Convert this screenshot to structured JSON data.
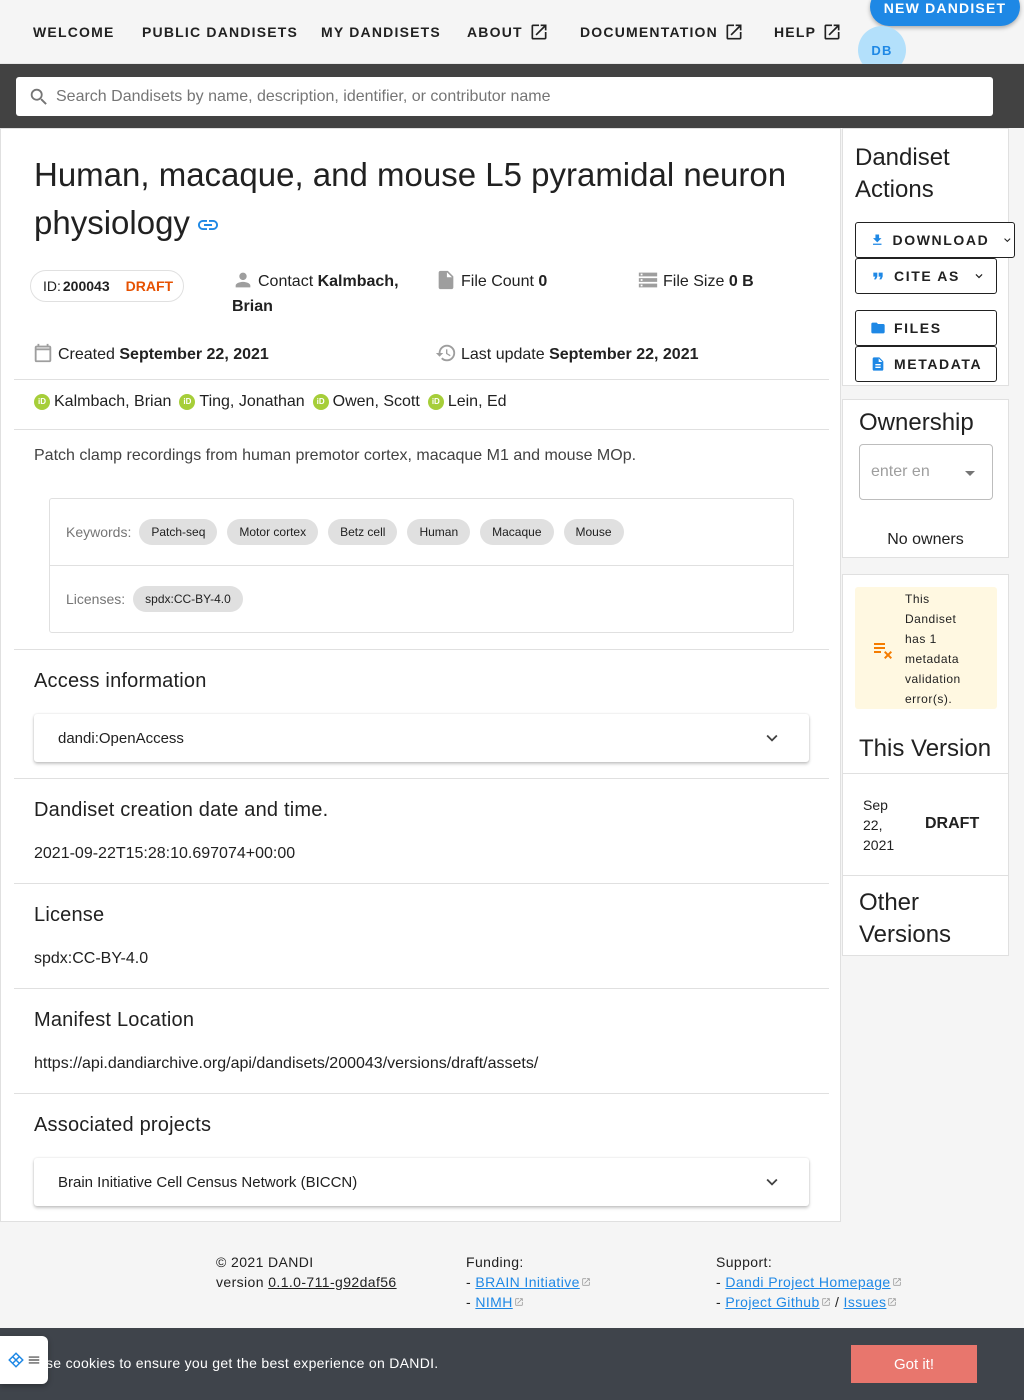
{
  "nav": {
    "welcome": "WELCOME",
    "public_dandisets": "PUBLIC DANDISETS",
    "my_dandisets": "MY DANDISETS",
    "about": "ABOUT",
    "documentation": "DOCUMENTATION",
    "help": "HELP",
    "new_dandiset": "NEW DANDISET",
    "avatar_initials": "DB"
  },
  "search": {
    "placeholder": "Search Dandisets by name, description, identifier, or contributor name"
  },
  "dandiset": {
    "title": "Human, macaque, and mouse L5 pyramidal neuron physiology",
    "id_label": "ID:",
    "id": "200043",
    "status": "DRAFT",
    "contact_label": "Contact",
    "contact_name": "Kalmbach, Brian",
    "file_count_label": "File Count",
    "file_count": "0",
    "file_size_label": "File Size",
    "file_size": "0 B",
    "created_label": "Created",
    "created": "September 22, 2021",
    "last_update_label": "Last update",
    "last_update": "September 22, 2021",
    "contributors": [
      "Kalmbach, Brian",
      "Ting, Jonathan",
      "Owen, Scott",
      "Lein, Ed"
    ],
    "description": "Patch clamp recordings from human premotor cortex, macaque M1 and mouse MOp.",
    "keywords_label": "Keywords:",
    "keywords": [
      "Patch-seq",
      "Motor cortex",
      "Betz cell",
      "Human",
      "Macaque",
      "Mouse"
    ],
    "licenses_label": "Licenses:",
    "licenses": [
      "spdx:CC-BY-4.0"
    ]
  },
  "sections": {
    "access_title": "Access information",
    "access_value": "dandi:OpenAccess",
    "creation_title": "Dandiset creation date and time.",
    "creation_value": "2021-09-22T15:28:10.697074+00:00",
    "license_title": "License",
    "license_value": "spdx:CC-BY-4.0",
    "manifest_title": "Manifest Location",
    "manifest_value": "https://api.dandiarchive.org/api/dandisets/200043/versions/draft/assets/",
    "projects_title": "Associated projects",
    "projects_value": "Brain Initiative Cell Census Network (BICCN)"
  },
  "sidebar": {
    "actions_title": "Dandiset Actions",
    "download": "DOWNLOAD",
    "cite_as": "CITE AS",
    "files": "FILES",
    "metadata": "METADATA",
    "ownership_title": "Ownership",
    "owner_placeholder": "enter en",
    "no_owners": "No owners",
    "validation_warning": "This Dandiset has 1 metadata validation error(s).",
    "this_version_title": "This Version",
    "version_date": "Sep 22, 2021",
    "version_label": "DRAFT",
    "other_versions_title": "Other Versions"
  },
  "footer": {
    "copyright": "© 2021 DANDI",
    "version_label": "version",
    "version": "0.1.0-711-g92daf56",
    "funding_label": "Funding:",
    "funding_links": [
      "BRAIN Initiative",
      "NIMH"
    ],
    "support_label": "Support:",
    "support_links": [
      "Dandi Project Homepage",
      "Project Github",
      "Issues"
    ]
  },
  "cookie": {
    "text": "se cookies to ensure you get the best experience on DANDI.",
    "button": "Got it!"
  },
  "colors": {
    "primary": "#1e88e5",
    "draft": "#e65100",
    "orcid": "#a6ce39",
    "warning_bg": "#fff8e1",
    "warning_icon": "#f57c00",
    "cookie_bg": "#3f444b",
    "cookie_button": "#e8766d"
  }
}
